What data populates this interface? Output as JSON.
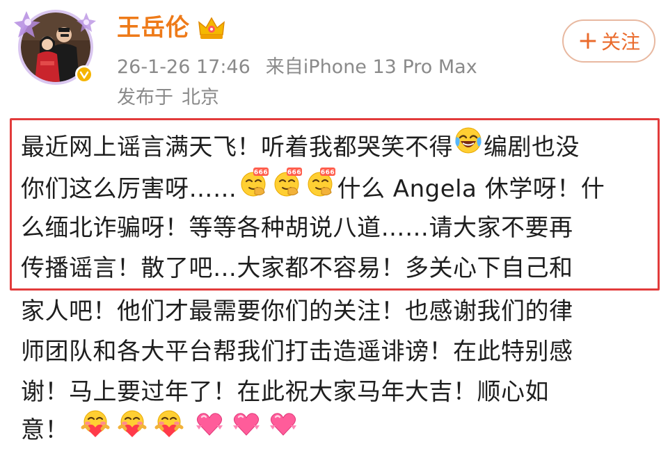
{
  "user": {
    "name": "王岳伦",
    "avatar_icon": "user-avatar-photo",
    "vip_badge_icon": "verified-badge-icon",
    "crown_icon": "crown-icon"
  },
  "meta": {
    "timestamp": "26-1-26 17:46",
    "source": "来自iPhone 13 Pro Max",
    "location_prefix": "发布于",
    "location": "北京"
  },
  "follow_button": {
    "plus": "+",
    "label": "关注"
  },
  "post": {
    "lines": [
      {
        "segments": [
          "最近网上谣言满天飞！听着我都哭笑不得",
          "编剧也没"
        ]
      },
      {
        "segments": [
          "你们这么厉害呀……",
          "什么 Angela 休学呀！什"
        ]
      },
      {
        "segments": [
          "么缅北诈骗呀！等等各种胡说八道……请大家不要再"
        ]
      },
      {
        "segments": [
          "传播谣言！散了吧…大家都不容易！多关心下自己和"
        ]
      },
      {
        "segments": [
          "家人吧！他们才最需要你们的关注！也感谢我们的律"
        ]
      },
      {
        "segments": [
          "师团队和各大平台帮我们打击造遥诽谤！在此特别感"
        ]
      },
      {
        "segments": [
          "谢！马上要过年了！在此祝大家马年大吉！顺心如"
        ]
      },
      {
        "segments": [
          "意！"
        ]
      }
    ],
    "emoji_texts": {
      "six": "666"
    }
  },
  "colors": {
    "name": "#ee7a18",
    "meta": "#8a8a8a",
    "follow": "#ea6b2c",
    "highlight_border": "#e23b3b"
  }
}
